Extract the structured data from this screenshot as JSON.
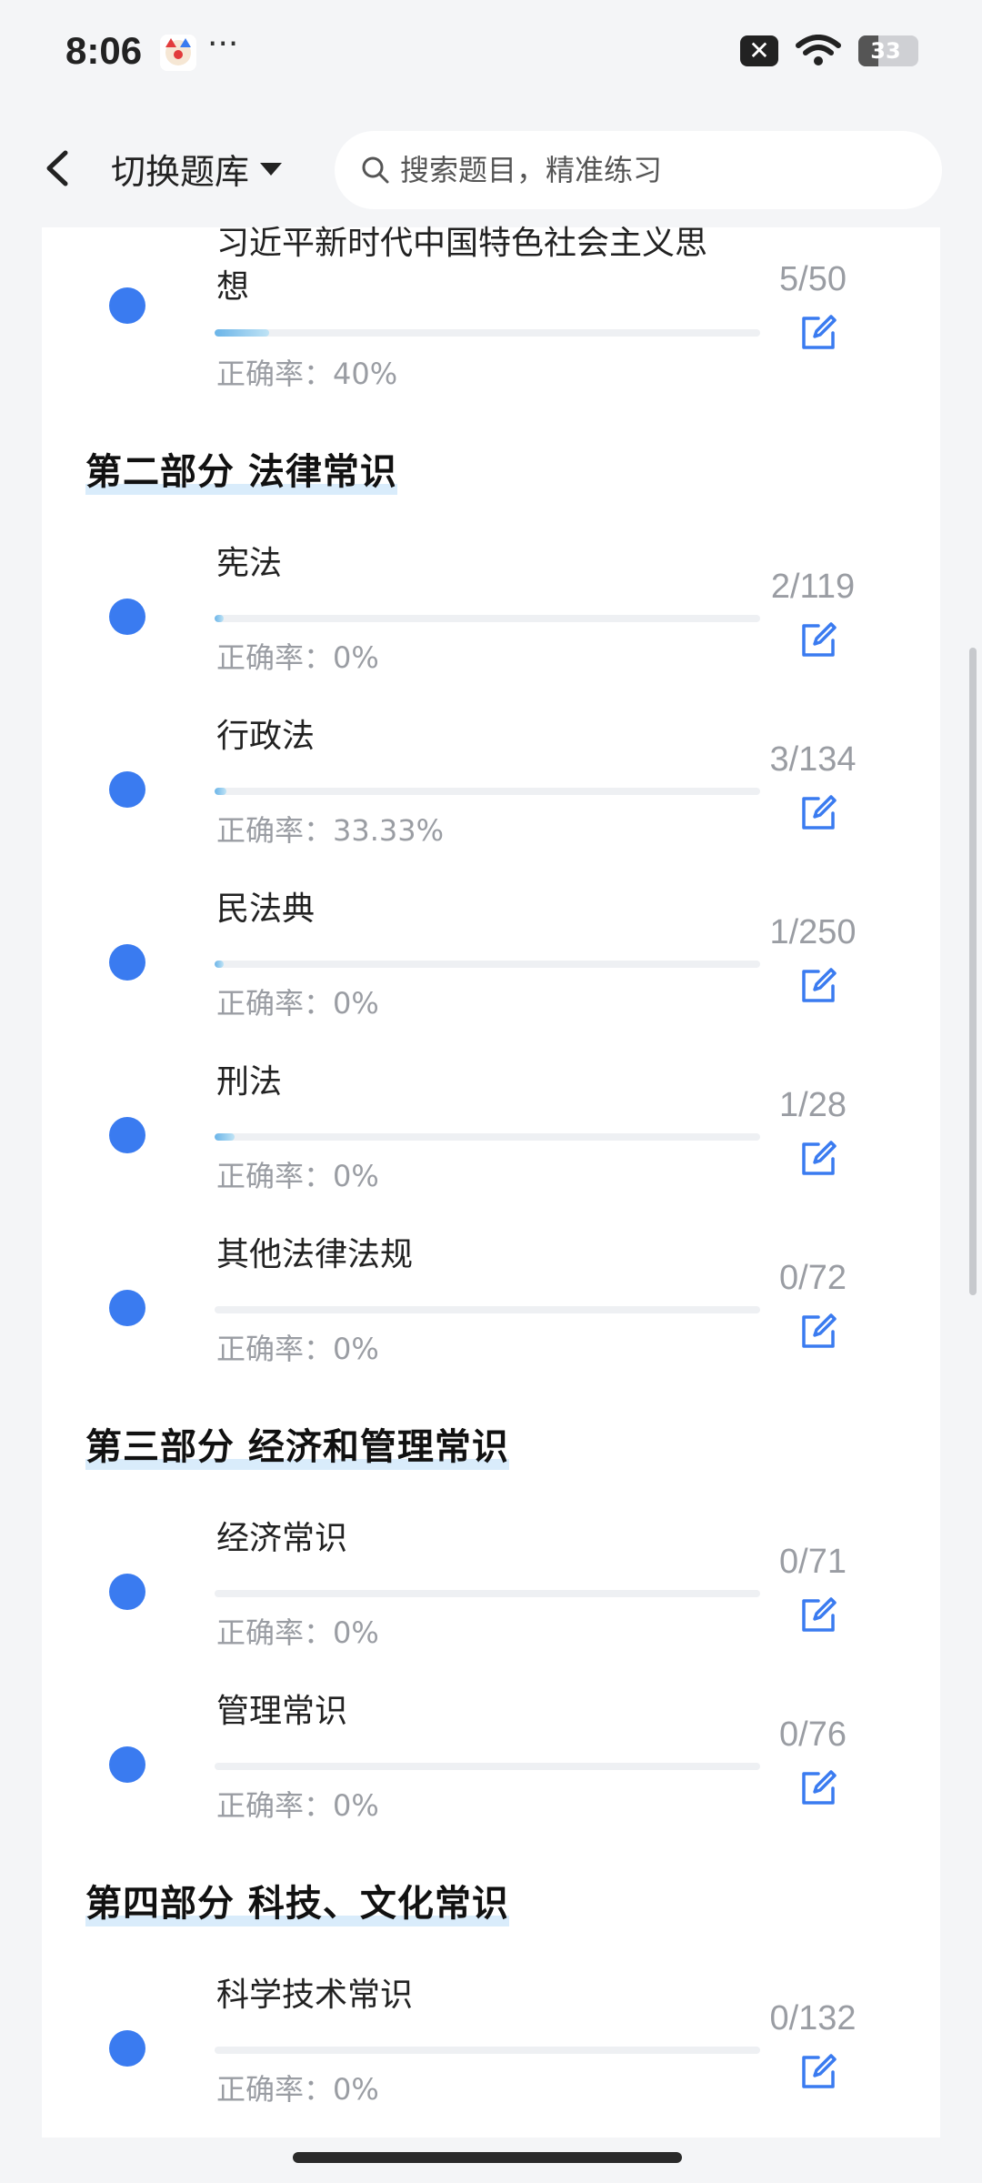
{
  "status": {
    "time": "8:06",
    "dots": "···",
    "battery": "33"
  },
  "header": {
    "back_icon": "chevron-left-icon",
    "switch_label": "切换题库",
    "search_placeholder": "搜索题目，精准练习"
  },
  "accent_color": "#3a7bf0",
  "top_item": {
    "name_line1": "习近平新时代中国特色社会主义思",
    "name_line2": "想",
    "count": "5/50",
    "accuracy": "正确率：40%",
    "progress": 0.1
  },
  "sections": [
    {
      "title": "第二部分  法律常识"
    },
    {
      "title": "第三部分  经济和管理常识"
    },
    {
      "title": "第四部分  科技、文化常识"
    }
  ],
  "items": [
    {
      "name": "宪法",
      "count": "2/119",
      "accuracy": "正确率：0%",
      "progress": 0.017
    },
    {
      "name": "行政法",
      "count": "3/134",
      "accuracy": "正确率：33.33%",
      "progress": 0.022
    },
    {
      "name": "民法典",
      "count": "1/250",
      "accuracy": "正确率：0%",
      "progress": 0.004
    },
    {
      "name": "刑法",
      "count": "1/28",
      "accuracy": "正确率：0%",
      "progress": 0.036
    },
    {
      "name": "其他法律法规",
      "count": "0/72",
      "accuracy": "正确率：0%",
      "progress": 0
    },
    {
      "name": "经济常识",
      "count": "0/71",
      "accuracy": "正确率：0%",
      "progress": 0
    },
    {
      "name": "管理常识",
      "count": "0/76",
      "accuracy": "正确率：0%",
      "progress": 0
    },
    {
      "name": "科学技术常识",
      "count": "0/132",
      "accuracy": "正确率：0%",
      "progress": 0
    }
  ]
}
